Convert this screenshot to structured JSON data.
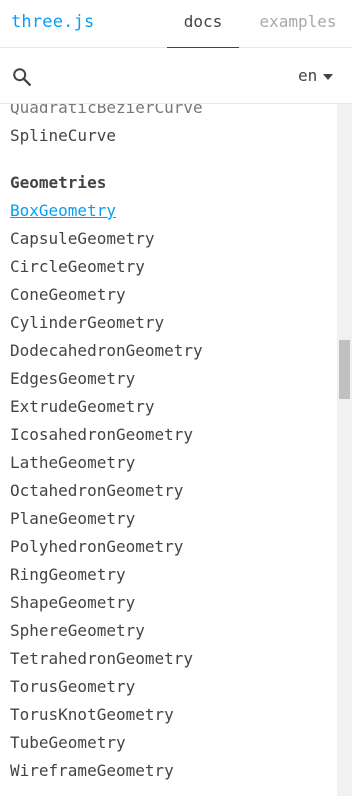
{
  "header": {
    "logo": "three.js",
    "tabs": [
      {
        "label": "docs",
        "active": true
      },
      {
        "label": "examples",
        "active": false
      }
    ]
  },
  "search": {
    "icon": "search-icon",
    "placeholder": "",
    "value": ""
  },
  "language": {
    "selected": "en",
    "icon": "caret-down-icon"
  },
  "nav": {
    "previous_items": [
      {
        "label": "QuadraticBezierCurve",
        "partially_hidden": true
      },
      {
        "label": "SplineCurve"
      }
    ],
    "section_title": "Geometries",
    "items": [
      {
        "label": "BoxGeometry",
        "selected": true
      },
      {
        "label": "CapsuleGeometry"
      },
      {
        "label": "CircleGeometry"
      },
      {
        "label": "ConeGeometry"
      },
      {
        "label": "CylinderGeometry"
      },
      {
        "label": "DodecahedronGeometry"
      },
      {
        "label": "EdgesGeometry"
      },
      {
        "label": "ExtrudeGeometry"
      },
      {
        "label": "IcosahedronGeometry"
      },
      {
        "label": "LatheGeometry"
      },
      {
        "label": "OctahedronGeometry"
      },
      {
        "label": "PlaneGeometry"
      },
      {
        "label": "PolyhedronGeometry"
      },
      {
        "label": "RingGeometry"
      },
      {
        "label": "ShapeGeometry"
      },
      {
        "label": "SphereGeometry"
      },
      {
        "label": "TetrahedronGeometry"
      },
      {
        "label": "TorusGeometry"
      },
      {
        "label": "TorusKnotGeometry"
      },
      {
        "label": "TubeGeometry"
      },
      {
        "label": "WireframeGeometry"
      }
    ]
  },
  "colors": {
    "accent": "#049ef4",
    "text": "#444444",
    "inactive_tab": "#a8a8a8",
    "divider": "#e8e8e8",
    "scroll_track": "#f1f1f1",
    "scroll_thumb": "#c1c1c1"
  }
}
